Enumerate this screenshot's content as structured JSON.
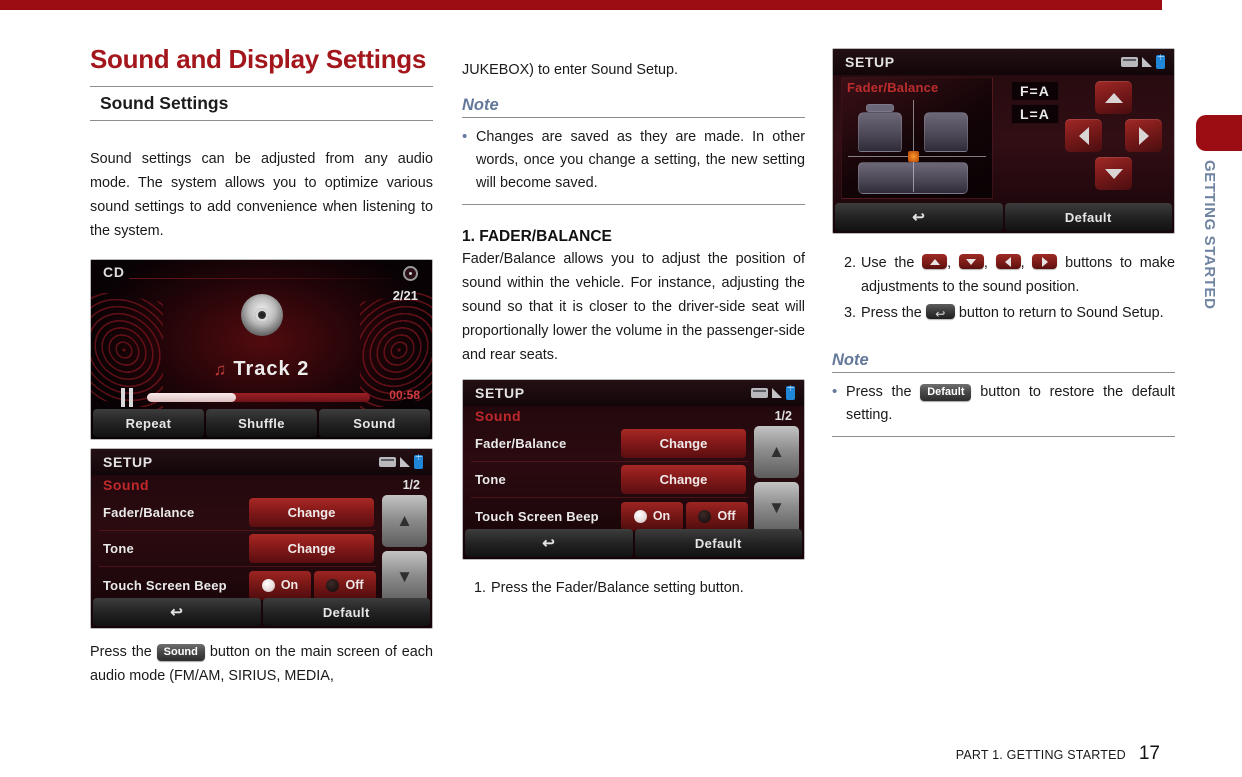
{
  "page": {
    "chapter_title": "Sound and Display Settings",
    "section_heading": "Sound Settings",
    "footer_text": "PART 1. GETTING STARTED",
    "footer_page": "17",
    "side_tab_label": "GETTING STARTED",
    "accent_red": "#9b0c13",
    "note_blue": "#63789a"
  },
  "column1": {
    "intro_paragraph": "Sound settings can be adjusted from any audio mode. The system allows you to optimize various sound settings to add convenience when listening to the system.",
    "caption_before_key": "Press the",
    "caption_key": "Sound",
    "caption_after_key": "button on the main screen of each audio mode (FM/AM, SIRIUS, MEDIA,"
  },
  "column2": {
    "continued_text": "JUKEBOX) to enter Sound Setup.",
    "note_title": "Note",
    "note_item": "Changes are saved as they are made. In other words, once you change a setting, the new setting will become saved.",
    "section_number_title": "1. FADER/BALANCE",
    "fader_paragraph": "Fader/Balance allows you to adjust the position of sound within the vehicle. For instance, adjusting the sound so that it is closer to the driver-side seat will proportionally lower the volume in the passenger-side and rear seats.",
    "step1_num": "1.",
    "step1_text": "Press the Fader/Balance setting button."
  },
  "column3": {
    "step2_num": "2.",
    "step2_text_a": "Use the",
    "step2_text_b": "buttons to make adjustments to the sound position.",
    "step3_num": "3.",
    "step3_text_a": "Press the",
    "step3_text_b": "button to return to Sound Setup.",
    "note_title": "Note",
    "note_before_key": "Press the",
    "note_key": "Default",
    "note_after_key": "button to restore the default setting."
  },
  "cd_screen": {
    "title": "CD",
    "track_counter": "2/21",
    "track_name": "Track  2",
    "elapsed_time": "00:58",
    "buttons": [
      "Repeat",
      "Shuffle",
      "Sound"
    ]
  },
  "setup_screen": {
    "title": "SETUP",
    "subtitle": "Sound",
    "page_indicator": "1/2",
    "rows": [
      {
        "label": "Fader/Balance",
        "control": "Change"
      },
      {
        "label": "Tone",
        "control": "Change"
      }
    ],
    "beep_label": "Touch Screen Beep",
    "beep_on": "On",
    "beep_off": "Off",
    "bottom_back": "",
    "bottom_default": "Default"
  },
  "fader_screen": {
    "title": "SETUP",
    "panel_title": "Fader/Balance",
    "value_fader": "F=A",
    "value_balance": "L=A",
    "bottom_default": "Default"
  }
}
